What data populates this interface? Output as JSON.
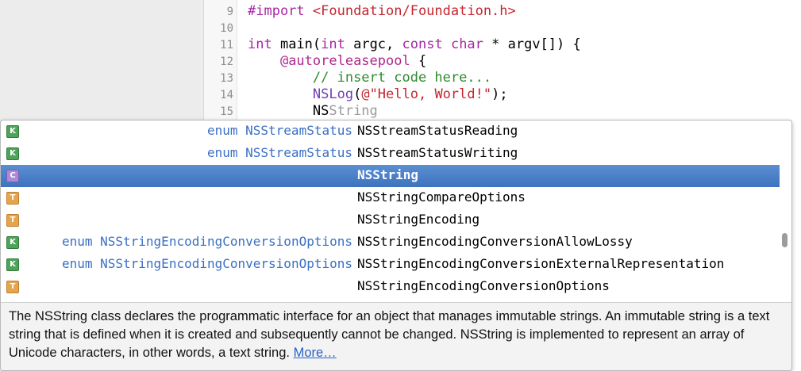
{
  "editor": {
    "lines": [
      {
        "num": "9",
        "segments": [
          {
            "t": "#import ",
            "c": "kw"
          },
          {
            "t": "<Foundation/Foundation.h>",
            "c": "str"
          }
        ]
      },
      {
        "num": "10",
        "segments": []
      },
      {
        "num": "11",
        "segments": [
          {
            "t": "int",
            "c": "kw"
          },
          {
            "t": " main(",
            "c": ""
          },
          {
            "t": "int",
            "c": "kw"
          },
          {
            "t": " argc, ",
            "c": ""
          },
          {
            "t": "const",
            "c": "kw"
          },
          {
            "t": " ",
            "c": ""
          },
          {
            "t": "char",
            "c": "kw"
          },
          {
            "t": " * argv[]) {",
            "c": ""
          }
        ]
      },
      {
        "num": "12",
        "segments": [
          {
            "t": "    ",
            "c": ""
          },
          {
            "t": "@autoreleasepool",
            "c": "kw2"
          },
          {
            "t": " {",
            "c": ""
          }
        ]
      },
      {
        "num": "13",
        "segments": [
          {
            "t": "        ",
            "c": ""
          },
          {
            "t": "// insert code here...",
            "c": "cmt"
          }
        ]
      },
      {
        "num": "14",
        "segments": [
          {
            "t": "        ",
            "c": ""
          },
          {
            "t": "NSLog",
            "c": "cls"
          },
          {
            "t": "(",
            "c": ""
          },
          {
            "t": "@\"Hello, World!\"",
            "c": "str"
          },
          {
            "t": ");",
            "c": ""
          }
        ]
      },
      {
        "num": "15",
        "segments": [
          {
            "t": "        NS",
            "c": ""
          },
          {
            "t": "String",
            "c": "ghost"
          }
        ]
      }
    ]
  },
  "completion": {
    "items": [
      {
        "badge": "K",
        "kind": "k",
        "type": "enum NSStreamStatus",
        "name": "NSStreamStatusReading",
        "selected": false
      },
      {
        "badge": "K",
        "kind": "k",
        "type": "enum NSStreamStatus",
        "name": "NSStreamStatusWriting",
        "selected": false
      },
      {
        "badge": "C",
        "kind": "c",
        "type": "",
        "name": "NSString",
        "selected": true
      },
      {
        "badge": "T",
        "kind": "t",
        "type": "",
        "name": "NSStringCompareOptions",
        "selected": false
      },
      {
        "badge": "T",
        "kind": "t",
        "type": "",
        "name": "NSStringEncoding",
        "selected": false
      },
      {
        "badge": "K",
        "kind": "k",
        "type": "enum NSStringEncodingConversionOptions",
        "name": "NSStringEncodingConversionAllowLossy",
        "selected": false
      },
      {
        "badge": "K",
        "kind": "k",
        "type": "enum NSStringEncodingConversionOptions",
        "name": "NSStringEncodingConversionExternalRepresentation",
        "selected": false
      },
      {
        "badge": "T",
        "kind": "t",
        "type": "",
        "name": "NSStringEncodingConversionOptions",
        "selected": false
      }
    ],
    "doc": {
      "text": "The NSString class declares the programmatic interface for an object that manages immutable strings. An immutable string is a text string that is defined when it is created and subsequently cannot be changed. NSString is implemented to represent an array of Unicode characters, in other words, a text string.",
      "more_label": "More…"
    }
  }
}
